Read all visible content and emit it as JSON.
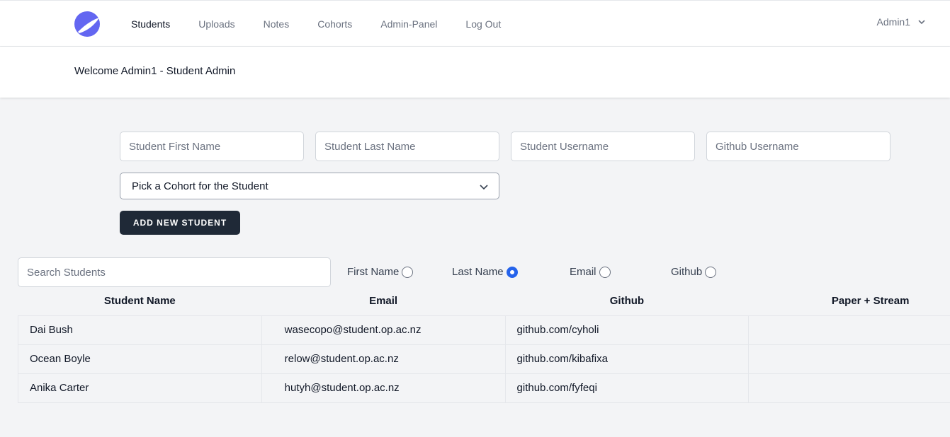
{
  "nav": {
    "items": [
      {
        "label": "Students",
        "active": true
      },
      {
        "label": "Uploads",
        "active": false
      },
      {
        "label": "Notes",
        "active": false
      },
      {
        "label": "Cohorts",
        "active": false
      },
      {
        "label": "Admin-Panel",
        "active": false
      },
      {
        "label": "Log Out",
        "active": false
      }
    ],
    "user": "Admin1"
  },
  "header": {
    "welcome": "Welcome Admin1 - Student Admin"
  },
  "form": {
    "first_name_placeholder": "Student First Name",
    "last_name_placeholder": "Student Last Name",
    "username_placeholder": "Student Username",
    "github_placeholder": "Github Username",
    "cohort_select": "Pick a Cohort for the Student",
    "add_button": "ADD NEW STUDENT"
  },
  "search": {
    "placeholder": "Search Students",
    "options": [
      {
        "label": "First Name",
        "checked": false
      },
      {
        "label": "Last Name",
        "checked": true
      },
      {
        "label": "Email",
        "checked": false
      },
      {
        "label": "Github",
        "checked": false
      }
    ]
  },
  "table": {
    "headers": [
      "Student Name",
      "Email",
      "Github",
      "Paper + Stream"
    ],
    "rows": [
      {
        "name": "Dai Bush",
        "email": "wasecopo@student.op.ac.nz",
        "github": "github.com/cyholi",
        "paper": ""
      },
      {
        "name": "Ocean Boyle",
        "email": "relow@student.op.ac.nz",
        "github": "github.com/kibafixa",
        "paper": ""
      },
      {
        "name": "Anika Carter",
        "email": "hutyh@student.op.ac.nz",
        "github": "github.com/fyfeqi",
        "paper": ""
      }
    ]
  },
  "colors": {
    "accent": "#818cf8",
    "brand": "#6366f1",
    "button": "#1f2937",
    "radio": "#2563eb"
  }
}
